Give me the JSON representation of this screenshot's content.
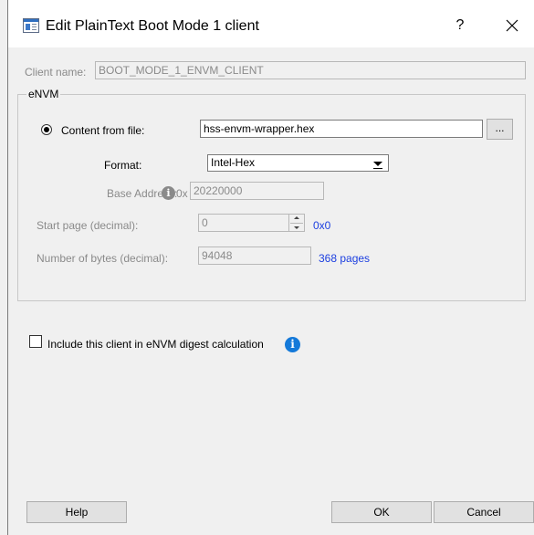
{
  "dialog": {
    "title": "Edit PlainText Boot Mode 1 client",
    "help_glyph": "?",
    "close_glyph": "✕"
  },
  "client_name": {
    "label": "Client name:",
    "value": "BOOT_MODE_1_ENVM_CLIENT"
  },
  "envm": {
    "group_title": "eNVM",
    "content_from_file": {
      "label": "Content from file:",
      "selected": true,
      "value": "hss-envm-wrapper.hex",
      "browse_label": "..."
    },
    "format": {
      "label": "Format:",
      "selected": "Intel-Hex"
    },
    "base_address": {
      "label": "Base Address:",
      "info_glyph": "i",
      "prefix": "0x",
      "value": "20220000"
    },
    "start_page": {
      "label": "Start page (decimal):",
      "value": "0",
      "hex_value": "0x0"
    },
    "number_of_bytes": {
      "label": "Number of bytes (decimal):",
      "value": "94048",
      "pages": "368 pages"
    }
  },
  "digest": {
    "label": "Include this client in eNVM digest calculation",
    "checked": false,
    "info_glyph": "i"
  },
  "buttons": {
    "help": "Help",
    "ok": "OK",
    "cancel": "Cancel"
  },
  "colors": {
    "info_blue": "#1479d9",
    "link_blue": "#1c3fe0",
    "disabled_text": "#8a8a8a"
  }
}
